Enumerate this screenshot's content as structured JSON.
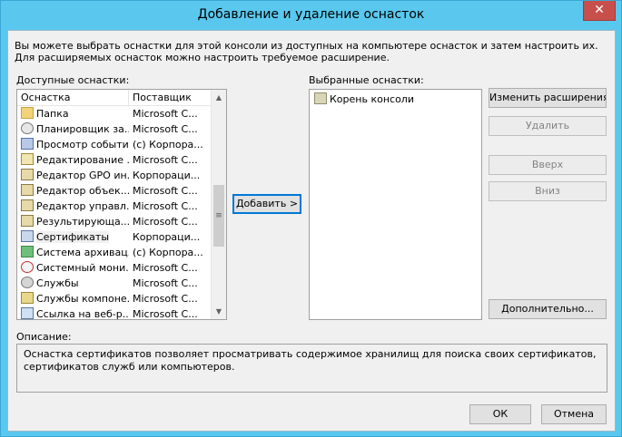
{
  "window": {
    "title": "Добавление и удаление оснасток",
    "close_glyph": "✕"
  },
  "intro_text": "Вы можете выбрать оснастки для этой консоли из доступных на компьютере оснасток и затем настроить их. Для расширяемых оснасток можно настроить требуемое расширение.",
  "available": {
    "label": "Доступные оснастки:",
    "columns": [
      "Оснастка",
      "Поставщик"
    ],
    "items": [
      {
        "name": "Папка",
        "vendor": "Microsoft C...",
        "icon": "folder-icon"
      },
      {
        "name": "Планировщик за...",
        "vendor": "Microsoft C...",
        "icon": "clock-icon"
      },
      {
        "name": "Просмотр событий",
        "vendor": "(c) Корпора...",
        "icon": "event-viewer-icon"
      },
      {
        "name": "Редактирование ...",
        "vendor": "Microsoft C...",
        "icon": "edit-icon"
      },
      {
        "name": "Редактор GPO ин...",
        "vendor": "Корпораци...",
        "icon": "gpo-icon"
      },
      {
        "name": "Редактор объек...",
        "vendor": "Microsoft C...",
        "icon": "object-editor-icon"
      },
      {
        "name": "Редактор управл...",
        "vendor": "Microsoft C...",
        "icon": "management-editor-icon"
      },
      {
        "name": "Результирующа...",
        "vendor": "Microsoft C...",
        "icon": "result-icon"
      },
      {
        "name": "Сертификаты",
        "vendor": "Корпораци...",
        "icon": "certificate-icon"
      },
      {
        "name": "Система архивац...",
        "vendor": "(c) Корпора...",
        "icon": "backup-icon"
      },
      {
        "name": "Системный мони...",
        "vendor": "Microsoft C...",
        "icon": "system-monitor-icon"
      },
      {
        "name": "Службы",
        "vendor": "Microsoft C...",
        "icon": "services-icon"
      },
      {
        "name": "Службы компоне...",
        "vendor": "Microsoft C...",
        "icon": "component-services-icon"
      },
      {
        "name": "Ссылка на веб-р...",
        "vendor": "Microsoft C...",
        "icon": "web-link-icon"
      }
    ],
    "selected_index": 8
  },
  "add_button": "Добавить >",
  "selected": {
    "label": "Выбранные оснастки:",
    "items": [
      {
        "name": "Корень консоли",
        "icon": "console-root-icon"
      }
    ]
  },
  "buttons": {
    "edit_extensions": "Изменить расширения...",
    "remove": "Удалить",
    "up": "Вверх",
    "down": "Вниз",
    "advanced": "Дополнительно...",
    "ok": "ОК",
    "cancel": "Отмена"
  },
  "description": {
    "label": "Описание:",
    "text": "Оснастка сертификатов позволяет просматривать содержимое хранилищ для поиска своих сертификатов, сертификатов служб или компьютеров."
  }
}
